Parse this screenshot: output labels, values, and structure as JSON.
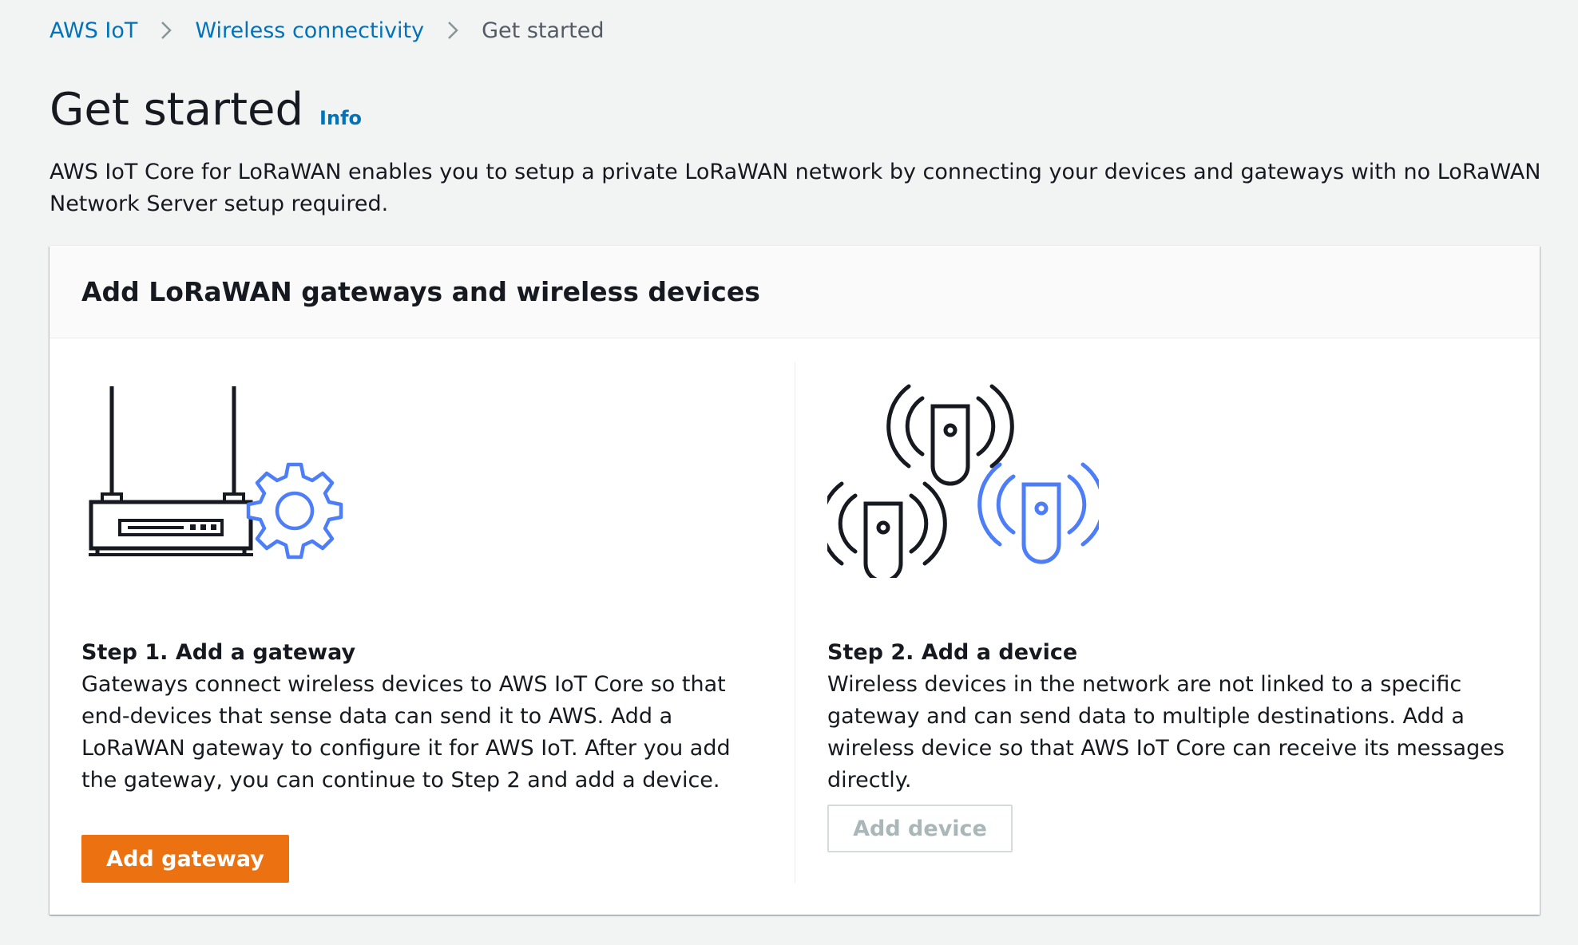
{
  "breadcrumb": {
    "items": [
      "AWS IoT",
      "Wireless connectivity"
    ],
    "current": "Get started"
  },
  "header": {
    "title": "Get started",
    "info_label": "Info"
  },
  "description": "AWS IoT Core for LoRaWAN enables you to setup a private LoRaWAN network by connecting your devices and gateways with no LoRaWAN Network Server setup required.",
  "container": {
    "title": "Add LoRaWAN gateways and wireless devices",
    "steps": [
      {
        "title": "Step 1. Add a gateway",
        "description": "Gateways connect wireless devices to AWS IoT Core so that end-devices that sense data can send it to AWS. Add a LoRaWAN gateway to configure it for AWS IoT. After you add the gateway, you can continue to Step 2 and add a device.",
        "button_label": "Add gateway",
        "icon": "gateway-router-gear-icon"
      },
      {
        "title": "Step 2. Add a device",
        "description": "Wireless devices in the network are not linked to a specific gateway and can send data to multiple destinations. Add a wireless device so that AWS IoT Core can receive its messages directly.",
        "button_label": "Add device",
        "icon": "wireless-devices-icon"
      }
    ]
  },
  "colors": {
    "link": "#0073bb",
    "primary_button": "#ec7211",
    "icon_accent": "#4d7ef7",
    "icon_line": "#16191f",
    "page_background": "#f2f3f3"
  }
}
